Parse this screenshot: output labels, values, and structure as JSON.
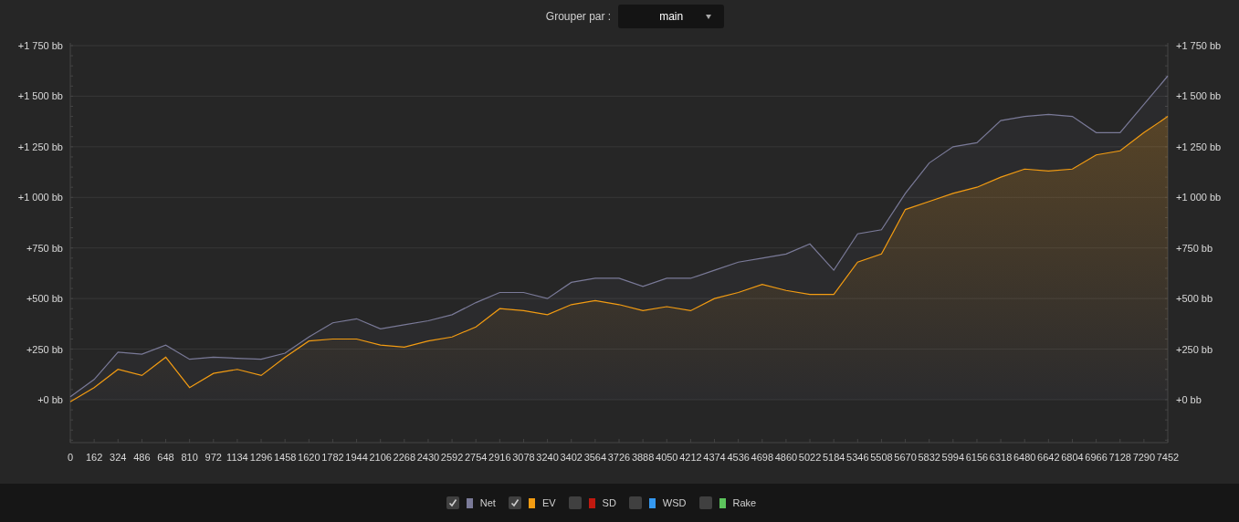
{
  "group_by": {
    "label": "Grouper par :",
    "value": "main"
  },
  "chart_data": {
    "type": "area",
    "grid": true,
    "x": [
      0,
      162,
      324,
      486,
      648,
      810,
      972,
      1134,
      1296,
      1458,
      1620,
      1782,
      1944,
      2106,
      2268,
      2430,
      2592,
      2754,
      2916,
      3078,
      3240,
      3402,
      3564,
      3726,
      3888,
      4050,
      4212,
      4374,
      4536,
      4698,
      4860,
      5022,
      5184,
      5346,
      5508,
      5670,
      5832,
      5994,
      6156,
      6318,
      6480,
      6642,
      6804,
      6966,
      7128,
      7290,
      7452
    ],
    "series": [
      {
        "name": "Net",
        "color": "#7a7a98",
        "values": [
          15,
          100,
          235,
          225,
          270,
          200,
          210,
          205,
          200,
          230,
          310,
          380,
          400,
          350,
          370,
          390,
          420,
          480,
          530,
          530,
          500,
          580,
          600,
          600,
          560,
          600,
          600,
          640,
          680,
          700,
          720,
          770,
          640,
          820,
          840,
          1020,
          1170,
          1250,
          1270,
          1380,
          1400,
          1410,
          1400,
          1320,
          1320,
          1460,
          1600
        ]
      },
      {
        "name": "EV",
        "color": "#f39c12",
        "values": [
          -10,
          60,
          150,
          120,
          210,
          60,
          130,
          150,
          120,
          210,
          290,
          300,
          300,
          270,
          260,
          290,
          310,
          360,
          450,
          440,
          420,
          470,
          490,
          470,
          440,
          460,
          440,
          500,
          530,
          570,
          540,
          520,
          520,
          680,
          720,
          940,
          980,
          1020,
          1050,
          1100,
          1140,
          1130,
          1140,
          1210,
          1230,
          1320,
          1400
        ]
      }
    ],
    "xlim": [
      0,
      7452
    ],
    "ylim": [
      -212,
      1750
    ],
    "xticks": [
      0,
      162,
      324,
      486,
      648,
      810,
      972,
      1134,
      1296,
      1458,
      1620,
      1782,
      1944,
      2106,
      2268,
      2430,
      2592,
      2754,
      2916,
      3078,
      3240,
      3402,
      3564,
      3726,
      3888,
      4050,
      4212,
      4374,
      4536,
      4698,
      4860,
      5022,
      5184,
      5346,
      5508,
      5670,
      5832,
      5994,
      6156,
      6318,
      6480,
      6642,
      6804,
      6966,
      7128,
      7290,
      7452
    ],
    "yticks": [
      {
        "value": 0,
        "label": "+0 bb"
      },
      {
        "value": 250,
        "label": "+250 bb"
      },
      {
        "value": 500,
        "label": "+500 bb"
      },
      {
        "value": 750,
        "label": "+750 bb"
      },
      {
        "value": 1000,
        "label": "+1 000 bb"
      },
      {
        "value": 1250,
        "label": "+1 250 bb"
      },
      {
        "value": 1500,
        "label": "+1 500 bb"
      },
      {
        "value": 1750,
        "label": "+1 750 bb"
      }
    ]
  },
  "legend": [
    {
      "kind": "series",
      "checked": true
    },
    {
      "kind": "series",
      "checked": true
    },
    {
      "kind": "plain",
      "label": "SD",
      "checked": false,
      "color": "#c0190f"
    },
    {
      "kind": "plain",
      "label": "WSD",
      "checked": false,
      "color": "#3498f0"
    },
    {
      "kind": "plain",
      "label": "Rake",
      "checked": false,
      "color": "#5cc45c"
    }
  ]
}
